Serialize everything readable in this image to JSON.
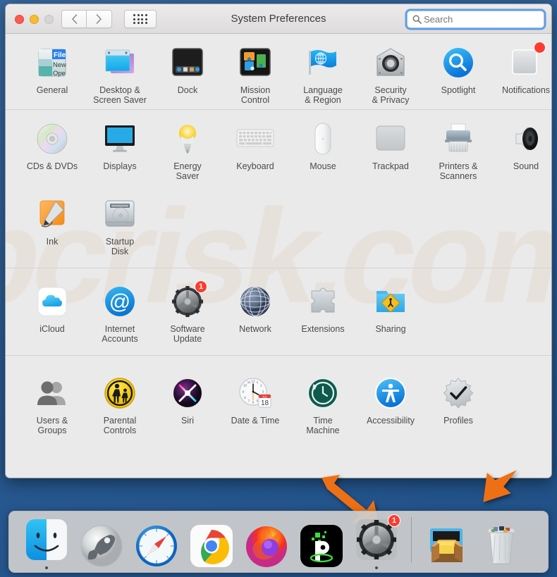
{
  "window": {
    "title": "System Preferences",
    "traffic_lights": [
      "close",
      "minimize",
      "zoom"
    ],
    "nav": {
      "back": "‹",
      "forward": "›",
      "grid": "grid-view"
    },
    "search": {
      "placeholder": "Search",
      "value": ""
    }
  },
  "watermark": "pcrisk.com",
  "sections": [
    {
      "id": "personal",
      "rows": [
        [
          {
            "name": "general",
            "label": "General",
            "icon": "general-icon"
          },
          {
            "name": "desktop",
            "label": "Desktop &\nScreen Saver",
            "icon": "desktop-screensaver-icon"
          },
          {
            "name": "dock",
            "label": "Dock",
            "icon": "dock-icon"
          },
          {
            "name": "mission-control",
            "label": "Mission\nControl",
            "icon": "mission-control-icon"
          },
          {
            "name": "language-region",
            "label": "Language\n& Region",
            "icon": "language-region-icon"
          },
          {
            "name": "security-privacy",
            "label": "Security\n& Privacy",
            "icon": "security-privacy-icon"
          },
          {
            "name": "spotlight",
            "label": "Spotlight",
            "icon": "spotlight-icon"
          },
          {
            "name": "notifications",
            "label": "Notifications",
            "icon": "notifications-icon",
            "badge": "dot"
          }
        ]
      ]
    },
    {
      "id": "hardware",
      "rows": [
        [
          {
            "name": "cds-dvds",
            "label": "CDs & DVDs",
            "icon": "cd-dvd-icon"
          },
          {
            "name": "displays",
            "label": "Displays",
            "icon": "display-icon"
          },
          {
            "name": "energy-saver",
            "label": "Energy\nSaver",
            "icon": "energy-saver-icon"
          },
          {
            "name": "keyboard",
            "label": "Keyboard",
            "icon": "keyboard-icon"
          },
          {
            "name": "mouse",
            "label": "Mouse",
            "icon": "mouse-icon"
          },
          {
            "name": "trackpad",
            "label": "Trackpad",
            "icon": "trackpad-icon"
          },
          {
            "name": "printers-scanners",
            "label": "Printers &\nScanners",
            "icon": "printer-icon"
          },
          {
            "name": "sound",
            "label": "Sound",
            "icon": "sound-icon"
          }
        ],
        [
          {
            "name": "ink",
            "label": "Ink",
            "icon": "ink-icon"
          },
          {
            "name": "startup-disk",
            "label": "Startup\nDisk",
            "icon": "startup-disk-icon"
          }
        ]
      ]
    },
    {
      "id": "internet-wireless",
      "rows": [
        [
          {
            "name": "icloud",
            "label": "iCloud",
            "icon": "icloud-icon"
          },
          {
            "name": "internet-accounts",
            "label": "Internet\nAccounts",
            "icon": "internet-accounts-icon"
          },
          {
            "name": "software-update",
            "label": "Software\nUpdate",
            "icon": "software-update-icon",
            "badge": "1"
          },
          {
            "name": "network",
            "label": "Network",
            "icon": "network-icon"
          },
          {
            "name": "extensions",
            "label": "Extensions",
            "icon": "extensions-icon"
          },
          {
            "name": "sharing",
            "label": "Sharing",
            "icon": "sharing-icon"
          }
        ]
      ]
    },
    {
      "id": "system",
      "rows": [
        [
          {
            "name": "users-groups",
            "label": "Users &\nGroups",
            "icon": "users-groups-icon"
          },
          {
            "name": "parental-controls",
            "label": "Parental\nControls",
            "icon": "parental-controls-icon"
          },
          {
            "name": "siri",
            "label": "Siri",
            "icon": "siri-icon"
          },
          {
            "name": "date-time",
            "label": "Date & Time",
            "icon": "date-time-icon",
            "calendar_day": "18",
            "calendar_month": "JUL"
          },
          {
            "name": "time-machine",
            "label": "Time\nMachine",
            "icon": "time-machine-icon"
          },
          {
            "name": "accessibility",
            "label": "Accessibility",
            "icon": "accessibility-icon"
          },
          {
            "name": "profiles",
            "label": "Profiles",
            "icon": "profiles-icon"
          }
        ]
      ]
    }
  ],
  "annotations": [
    {
      "name": "arrow-pointing-to-profiles",
      "color": "#ef7014",
      "direction": "up-right"
    },
    {
      "name": "arrow-pointing-to-dock-prefs",
      "color": "#ef7014",
      "direction": "down-right"
    }
  ],
  "dock": {
    "items": [
      {
        "name": "finder",
        "label": "Finder",
        "running": true
      },
      {
        "name": "launchpad",
        "label": "Launchpad",
        "running": false
      },
      {
        "name": "safari",
        "label": "Safari",
        "running": false
      },
      {
        "name": "chrome",
        "label": "Google Chrome",
        "running": false
      },
      {
        "name": "firefox",
        "label": "Firefox",
        "running": false
      },
      {
        "name": "pia",
        "label": "Private Internet Access",
        "running": false
      },
      {
        "name": "system-preferences",
        "label": "System Preferences",
        "running": true,
        "badge": "1"
      }
    ],
    "right_items": [
      {
        "name": "downloads-stack",
        "label": "Downloads"
      },
      {
        "name": "trash",
        "label": "Trash"
      }
    ]
  },
  "colors": {
    "accent_blue": "#5a9ee8",
    "arrow_orange": "#ef7014",
    "badge_red": "#ff3b30",
    "window_bg": "#eaeaea",
    "desktop_blue": "#2f6098"
  }
}
